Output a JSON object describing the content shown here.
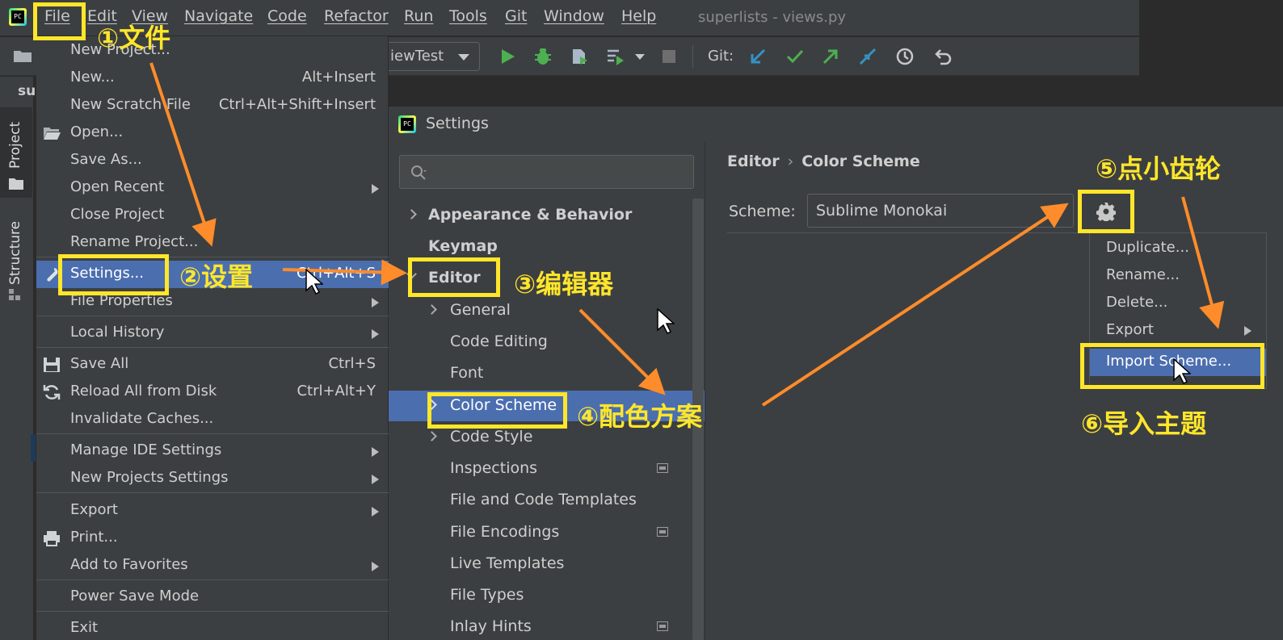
{
  "menubar": {
    "items": [
      "File",
      "Edit",
      "View",
      "Navigate",
      "Code",
      "Refactor",
      "Run",
      "Tools",
      "Git",
      "Window",
      "Help"
    ],
    "window_title": "superlists - views.py"
  },
  "toolbar": {
    "run_config": "iewTest",
    "git_label": "Git:"
  },
  "tool_window": {
    "project_tab": "Project",
    "structure_tab": "Structure",
    "panel_label": "sup"
  },
  "file_menu": {
    "items": [
      {
        "label": "New Project...",
        "shortcut": ""
      },
      {
        "label": "New...",
        "shortcut": "Alt+Insert"
      },
      {
        "label": "New Scratch File",
        "shortcut": "Ctrl+Alt+Shift+Insert"
      },
      {
        "label": "Open...",
        "shortcut": "",
        "icon": "folder-open-icon"
      },
      {
        "label": "Save As...",
        "shortcut": ""
      },
      {
        "label": "Open Recent",
        "shortcut": "",
        "submenu": true
      },
      {
        "label": "Close Project",
        "shortcut": ""
      },
      {
        "label": "Rename Project...",
        "shortcut": ""
      },
      {
        "label": "Settings...",
        "shortcut": "Ctrl+Alt+S",
        "icon": "wrench-icon",
        "selected": true
      },
      {
        "label": "File Properties",
        "shortcut": "",
        "submenu": true
      },
      {
        "label": "Local History",
        "shortcut": "",
        "submenu": true
      },
      {
        "label": "Save All",
        "shortcut": "Ctrl+S",
        "icon": "floppy-icon"
      },
      {
        "label": "Reload All from Disk",
        "shortcut": "Ctrl+Alt+Y",
        "icon": "reload-icon"
      },
      {
        "label": "Invalidate Caches...",
        "shortcut": ""
      },
      {
        "label": "Manage IDE Settings",
        "shortcut": "",
        "submenu": true
      },
      {
        "label": "New Projects Settings",
        "shortcut": "",
        "submenu": true
      },
      {
        "label": "Export",
        "shortcut": "",
        "submenu": true
      },
      {
        "label": "Print...",
        "shortcut": "",
        "icon": "printer-icon"
      },
      {
        "label": "Add to Favorites",
        "shortcut": "",
        "submenu": true
      },
      {
        "label": "Power Save Mode",
        "shortcut": ""
      },
      {
        "label": "Exit",
        "shortcut": ""
      }
    ]
  },
  "settings": {
    "title": "Settings",
    "search_placeholder": "",
    "nav": [
      {
        "label": "Appearance & Behavior",
        "bold": true,
        "chevron": "right"
      },
      {
        "label": "Keymap",
        "bold": true
      },
      {
        "label": "Editor",
        "bold": true,
        "chevron": "down"
      },
      {
        "label": "General",
        "chevron": "right"
      },
      {
        "label": "Code Editing"
      },
      {
        "label": "Font"
      },
      {
        "label": "Color Scheme",
        "chevron": "right",
        "selected": true
      },
      {
        "label": "Code Style",
        "chevron": "right"
      },
      {
        "label": "Inspections",
        "project_icon": true
      },
      {
        "label": "File and Code Templates"
      },
      {
        "label": "File Encodings",
        "project_icon": true
      },
      {
        "label": "Live Templates"
      },
      {
        "label": "File Types"
      },
      {
        "label": "Inlay Hints",
        "project_icon": true
      }
    ],
    "breadcrumb": [
      "Editor",
      "Color Scheme"
    ],
    "breadcrumb_sep": "›",
    "scheme_label": "Scheme:",
    "scheme_value": "Sublime Monokai",
    "gear_menu": [
      {
        "label": "Duplicate..."
      },
      {
        "label": "Rename..."
      },
      {
        "label": "Delete..."
      },
      {
        "label": "Export",
        "submenu": true
      },
      {
        "label": "Import Scheme...",
        "selected": true
      }
    ]
  },
  "annotations": {
    "step1": "①文件",
    "step2": "②设置",
    "step3": "③编辑器",
    "step4": "④配色方案",
    "step5": "⑤点小齿轮",
    "step6": "⑥导入主题"
  },
  "colors": {
    "highlight": "#ffe62a",
    "arrow": "#ff8c2a",
    "selection": "#4b6eaf"
  }
}
